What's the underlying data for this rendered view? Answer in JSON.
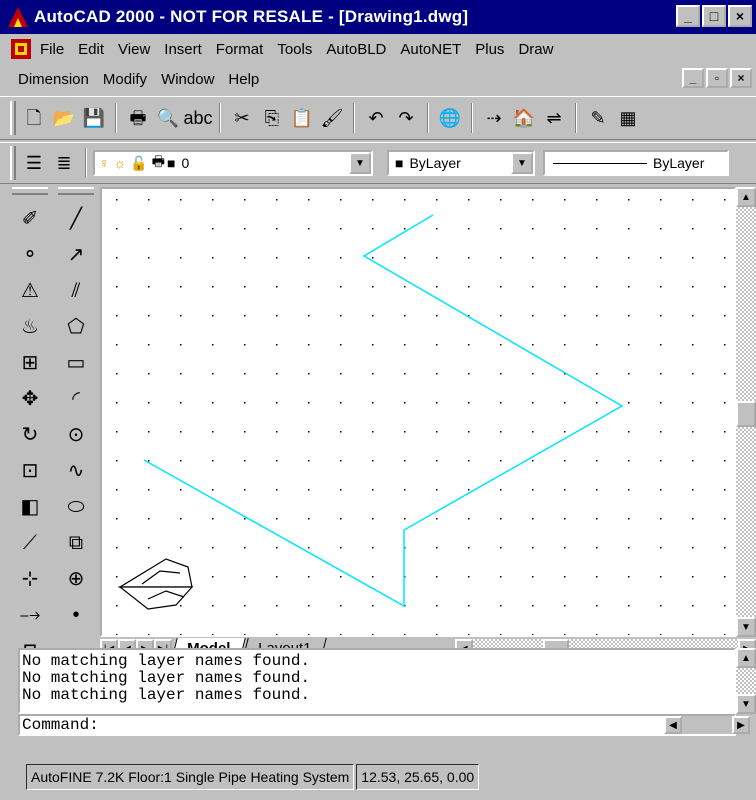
{
  "window": {
    "title": "AutoCAD 2000 - NOT FOR RESALE - [Drawing1.dwg]",
    "controls": [
      "_",
      "□",
      "×"
    ],
    "mdi_controls": [
      "_",
      "▫",
      "×"
    ]
  },
  "menu": {
    "row1": [
      "File",
      "Edit",
      "View",
      "Insert",
      "Format",
      "Tools",
      "AutoBLD",
      "AutoNET",
      "Plus",
      "Draw"
    ],
    "row2": [
      "Dimension",
      "Modify",
      "Window",
      "Help"
    ]
  },
  "standard_toolbar": {
    "icons": [
      "new-icon",
      "open-icon",
      "save-icon",
      "print-icon",
      "print-preview-icon",
      "spelling-icon",
      "cut-icon",
      "copy-icon",
      "paste-icon",
      "match-properties-icon",
      "undo-icon",
      "redo-icon",
      "web-icon",
      "distance-icon",
      "insert-block-icon",
      "dimension-icon",
      "properties-icon",
      "more-icon"
    ],
    "glyphs": [
      "🗋",
      "📂",
      "💾",
      "🖶",
      "🔍",
      "abc",
      "✂",
      "⎘",
      "📋",
      "🖌",
      "↶",
      "↷",
      "🌐",
      "⇢",
      "🏠",
      "⇌",
      "✎",
      "▦"
    ]
  },
  "layers_toolbar": {
    "layer_value": "0",
    "color_value": "ByLayer",
    "linetype_value": "ByLayer"
  },
  "modify_toolbar": {
    "icons": [
      "erase-icon",
      "copy-object-icon",
      "mirror-icon",
      "offset-icon",
      "array-icon",
      "move-icon",
      "rotate-icon",
      "scale-icon",
      "stretch-icon",
      "trim-icon",
      "extend-icon",
      "break-icon",
      "chamfer-icon"
    ],
    "glyphs": [
      "✐",
      "⚬",
      "⚠",
      "♨",
      "⊞",
      "✥",
      "↻",
      "⊡",
      "◧",
      "⟋",
      "⊹",
      "⤍",
      "⊓"
    ]
  },
  "draw_toolbar": {
    "icons": [
      "line-icon",
      "construction-line-icon",
      "polyline-icon",
      "polygon-icon",
      "rectangle-icon",
      "arc-icon",
      "circle-icon",
      "spline-icon",
      "ellipse-icon",
      "insert-block-icon",
      "make-block-icon",
      "point-icon"
    ],
    "glyphs": [
      "╱",
      "↗",
      "⫽",
      "⬠",
      "▭",
      "◜",
      "⊙",
      "∿",
      "⬭",
      "⧉",
      "⊕",
      "•"
    ]
  },
  "drawing": {
    "line_color": "#00e5ff"
  },
  "tabs": {
    "nav": [
      "|◀",
      "◀",
      "▶",
      "▶|"
    ],
    "items": [
      "Model",
      "Layout1"
    ],
    "active": "Model"
  },
  "command": {
    "history": [
      "No matching layer names found.",
      "No matching layer names found.",
      "No matching layer names found."
    ],
    "prompt": "Command:"
  },
  "status": {
    "app_info": "AutoFINE 7.2K Floor:1 Single Pipe Heating System",
    "coordinates": "12.53, 25.65, 0.00"
  }
}
